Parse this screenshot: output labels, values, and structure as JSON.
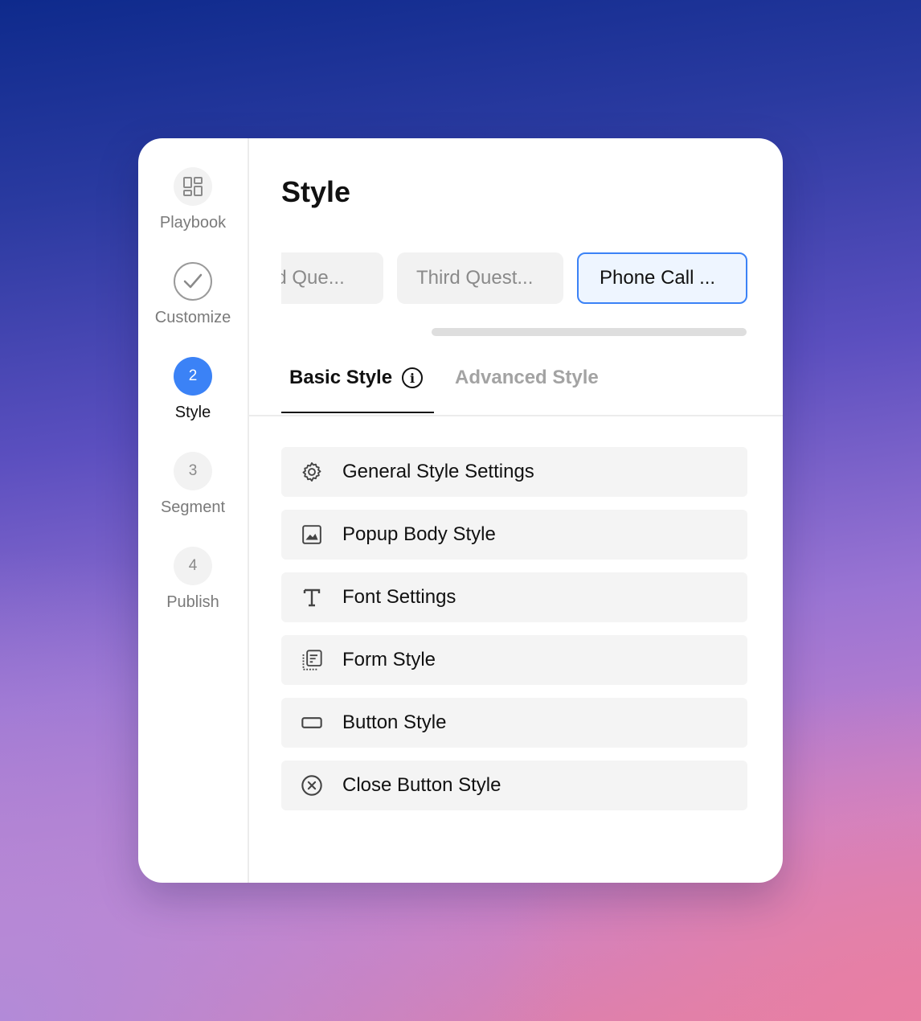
{
  "steps": [
    {
      "label": "Playbook",
      "number": "",
      "state": "pending",
      "icon": "grid-icon"
    },
    {
      "label": "Customize",
      "number": "",
      "state": "done",
      "icon": "check-icon"
    },
    {
      "label": "Style",
      "number": "2",
      "state": "active"
    },
    {
      "label": "Segment",
      "number": "3",
      "state": "pending"
    },
    {
      "label": "Publish",
      "number": "4",
      "state": "pending"
    }
  ],
  "page_title": "Style",
  "chips": [
    {
      "label": "nd Que..."
    },
    {
      "label": "Third Quest..."
    },
    {
      "label": "Phone Call ..."
    }
  ],
  "tabs": {
    "basic": "Basic Style",
    "advanced": "Advanced Style",
    "info_glyph": "i"
  },
  "style_items": [
    {
      "label": "General Style Settings",
      "icon": "gear-icon"
    },
    {
      "label": "Popup Body Style",
      "icon": "image-icon"
    },
    {
      "label": "Font Settings",
      "icon": "text-icon"
    },
    {
      "label": "Form Style",
      "icon": "form-icon"
    },
    {
      "label": "Button Style",
      "icon": "button-icon"
    },
    {
      "label": "Close Button Style",
      "icon": "close-circle-icon"
    }
  ],
  "colors": {
    "accent": "#3b82f6",
    "active_chip_bg": "#eef5ff"
  }
}
